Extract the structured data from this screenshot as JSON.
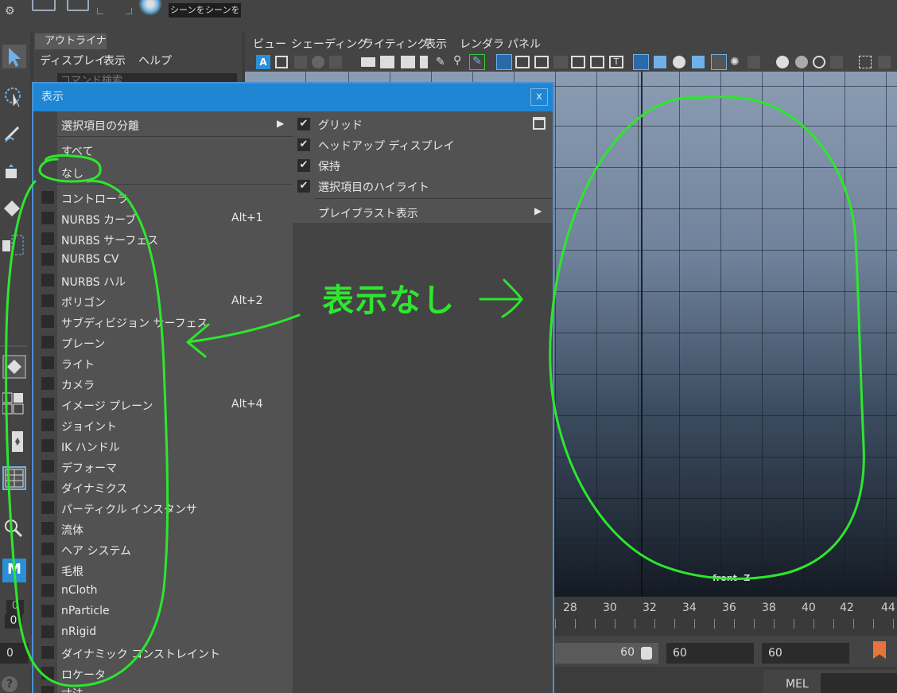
{
  "topbar": {
    "scene_btn_1": "シーンを",
    "scene_btn_2": "シーンを"
  },
  "outliner": {
    "tab": "アウトライナ",
    "menus": [
      "ディスプレイ",
      "表示",
      "ヘルプ"
    ],
    "search_placeholder": "コマンド検索"
  },
  "viewport": {
    "menus": [
      "ビュー",
      "シェーディング",
      "ライティング",
      "表示",
      "レンダラ",
      "パネル"
    ],
    "camera_label": "front -Z"
  },
  "timeline": {
    "ticks": [
      "28",
      "30",
      "32",
      "34",
      "36",
      "38",
      "40",
      "42",
      "44"
    ]
  },
  "range": {
    "start": "0",
    "current": "60",
    "end1": "60",
    "end2": "60"
  },
  "left_values": {
    "a": "0",
    "b": "0"
  },
  "cmdline": {
    "label": "MEL"
  },
  "dialog": {
    "title": "表示",
    "close": "x",
    "isolate": "選択項目の分離",
    "all": "すべて",
    "none": "なし",
    "items": [
      {
        "label": "コントローラ",
        "shortcut": ""
      },
      {
        "label": "NURBS カーブ",
        "shortcut": "Alt+1"
      },
      {
        "label": "NURBS サーフェス",
        "shortcut": ""
      },
      {
        "label": "NURBS CV",
        "shortcut": ""
      },
      {
        "label": "NURBS ハル",
        "shortcut": ""
      },
      {
        "label": "ポリゴン",
        "shortcut": "Alt+2"
      },
      {
        "label": "サブディビジョン サーフェス",
        "shortcut": ""
      },
      {
        "label": "プレーン",
        "shortcut": ""
      },
      {
        "label": "ライト",
        "shortcut": ""
      },
      {
        "label": "カメラ",
        "shortcut": ""
      },
      {
        "label": "イメージ プレーン",
        "shortcut": "Alt+4"
      },
      {
        "label": "ジョイント",
        "shortcut": ""
      },
      {
        "label": "IK ハンドル",
        "shortcut": ""
      },
      {
        "label": "デフォーマ",
        "shortcut": ""
      },
      {
        "label": "ダイナミクス",
        "shortcut": ""
      },
      {
        "label": "パーティクル インスタンサ",
        "shortcut": ""
      },
      {
        "label": "流体",
        "shortcut": ""
      },
      {
        "label": "ヘア システム",
        "shortcut": ""
      },
      {
        "label": "毛根",
        "shortcut": ""
      },
      {
        "label": "nCloth",
        "shortcut": ""
      },
      {
        "label": "nParticle",
        "shortcut": ""
      },
      {
        "label": "nRigid",
        "shortcut": ""
      },
      {
        "label": "ダイナミック コンストレイント",
        "shortcut": ""
      },
      {
        "label": "ロケータ",
        "shortcut": ""
      },
      {
        "label": "寸法",
        "shortcut": ""
      }
    ],
    "right_items": [
      {
        "label": "グリッド",
        "checked": true
      },
      {
        "label": "ヘッドアップ ディスプレイ",
        "checked": true
      },
      {
        "label": "保持",
        "checked": true
      },
      {
        "label": "選択項目のハイライト",
        "checked": true
      }
    ],
    "playblast": "プレイブラスト表示"
  },
  "annotation": {
    "text": "表示なし"
  },
  "colors": {
    "dialog_title": "#1f86d4",
    "annotation": "#2ee62e"
  }
}
